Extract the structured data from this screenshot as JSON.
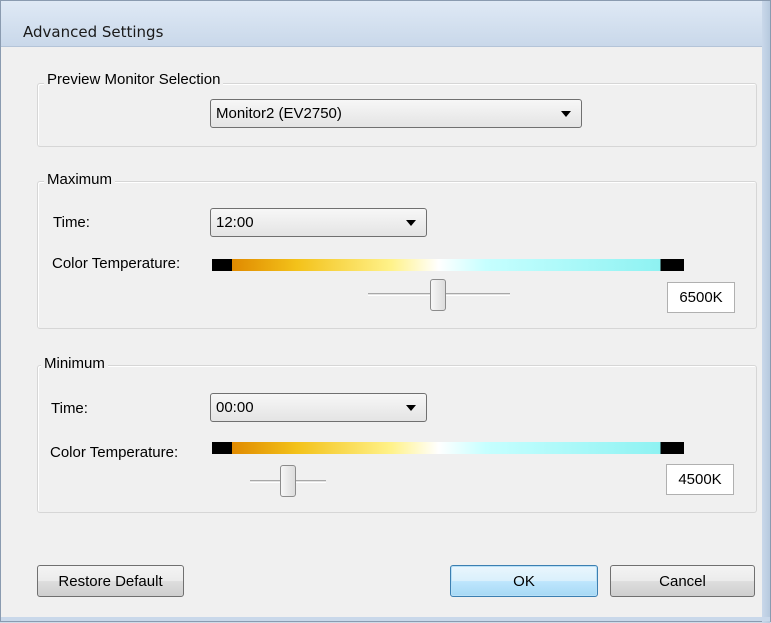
{
  "window": {
    "title": "Advanced Settings"
  },
  "preview": {
    "legend": "Preview Monitor Selection",
    "monitor_value": "Monitor2 (EV2750)"
  },
  "maximum": {
    "legend": "Maximum",
    "time_label": "Time:",
    "time_value": "12:00",
    "ct_label": "Color Temperature:",
    "ct_value": "6500K",
    "slider_fraction": 0.5
  },
  "minimum": {
    "legend": "Minimum",
    "time_label": "Time:",
    "time_value": "00:00",
    "ct_label": "Color Temperature:",
    "ct_value": "4500K",
    "slider_fraction": 0.5
  },
  "buttons": {
    "restore": "Restore Default",
    "ok": "OK",
    "cancel": "Cancel"
  },
  "colors": {
    "default_button_border": "#3c7fb1",
    "titlebar": "#dfe9f5"
  }
}
